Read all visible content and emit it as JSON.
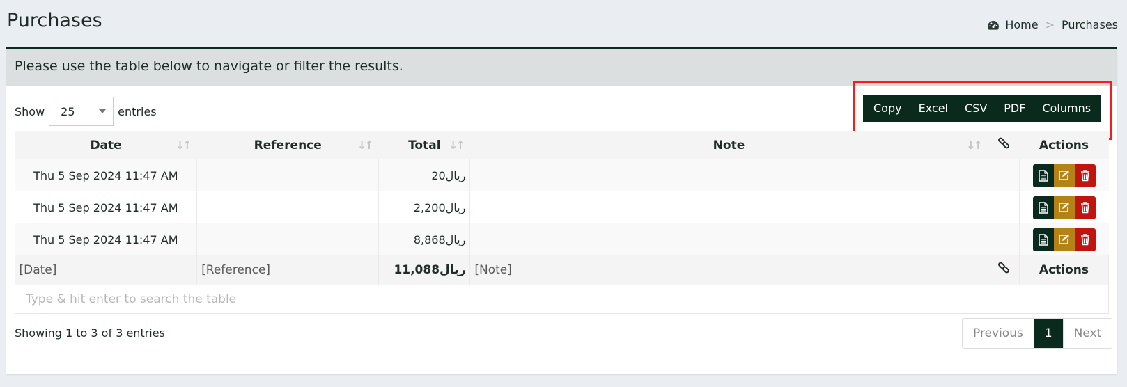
{
  "page": {
    "title": "Purchases"
  },
  "breadcrumb": {
    "home": "Home",
    "separator": ">",
    "current": "Purchases"
  },
  "box": {
    "header_text": "Please use the table below to navigate or filter the results."
  },
  "length_menu": {
    "show": "Show",
    "value": "25",
    "entries": "entries"
  },
  "buttons": {
    "copy": "Copy",
    "excel": "Excel",
    "csv": "CSV",
    "pdf": "PDF",
    "columns": "Columns"
  },
  "table": {
    "headers": {
      "date": "Date",
      "reference": "Reference",
      "total": "Total",
      "note": "Note",
      "actions": "Actions"
    },
    "rows": [
      {
        "date": "Thu 5 Sep 2024 11:47 AM",
        "reference": "",
        "total": "ريال20",
        "note": ""
      },
      {
        "date": "Thu 5 Sep 2024 11:47 AM",
        "reference": "",
        "total": "ريال2,200",
        "note": ""
      },
      {
        "date": "Thu 5 Sep 2024 11:47 AM",
        "reference": "",
        "total": "ريال8,868",
        "note": ""
      }
    ],
    "footer": {
      "date": "[Date]",
      "reference": "[Reference]",
      "total": "ريال11,088",
      "note": "[Note]",
      "actions": "Actions"
    },
    "search_placeholder": "Type & hit enter to search the table"
  },
  "info": "Showing 1 to 3 of 3 entries",
  "pagination": {
    "previous": "Previous",
    "current": "1",
    "next": "Next"
  },
  "colors": {
    "primary": "#0b2a1e",
    "edit": "#b58315",
    "delete": "#c0140f",
    "highlight": "#ff1a1a"
  }
}
